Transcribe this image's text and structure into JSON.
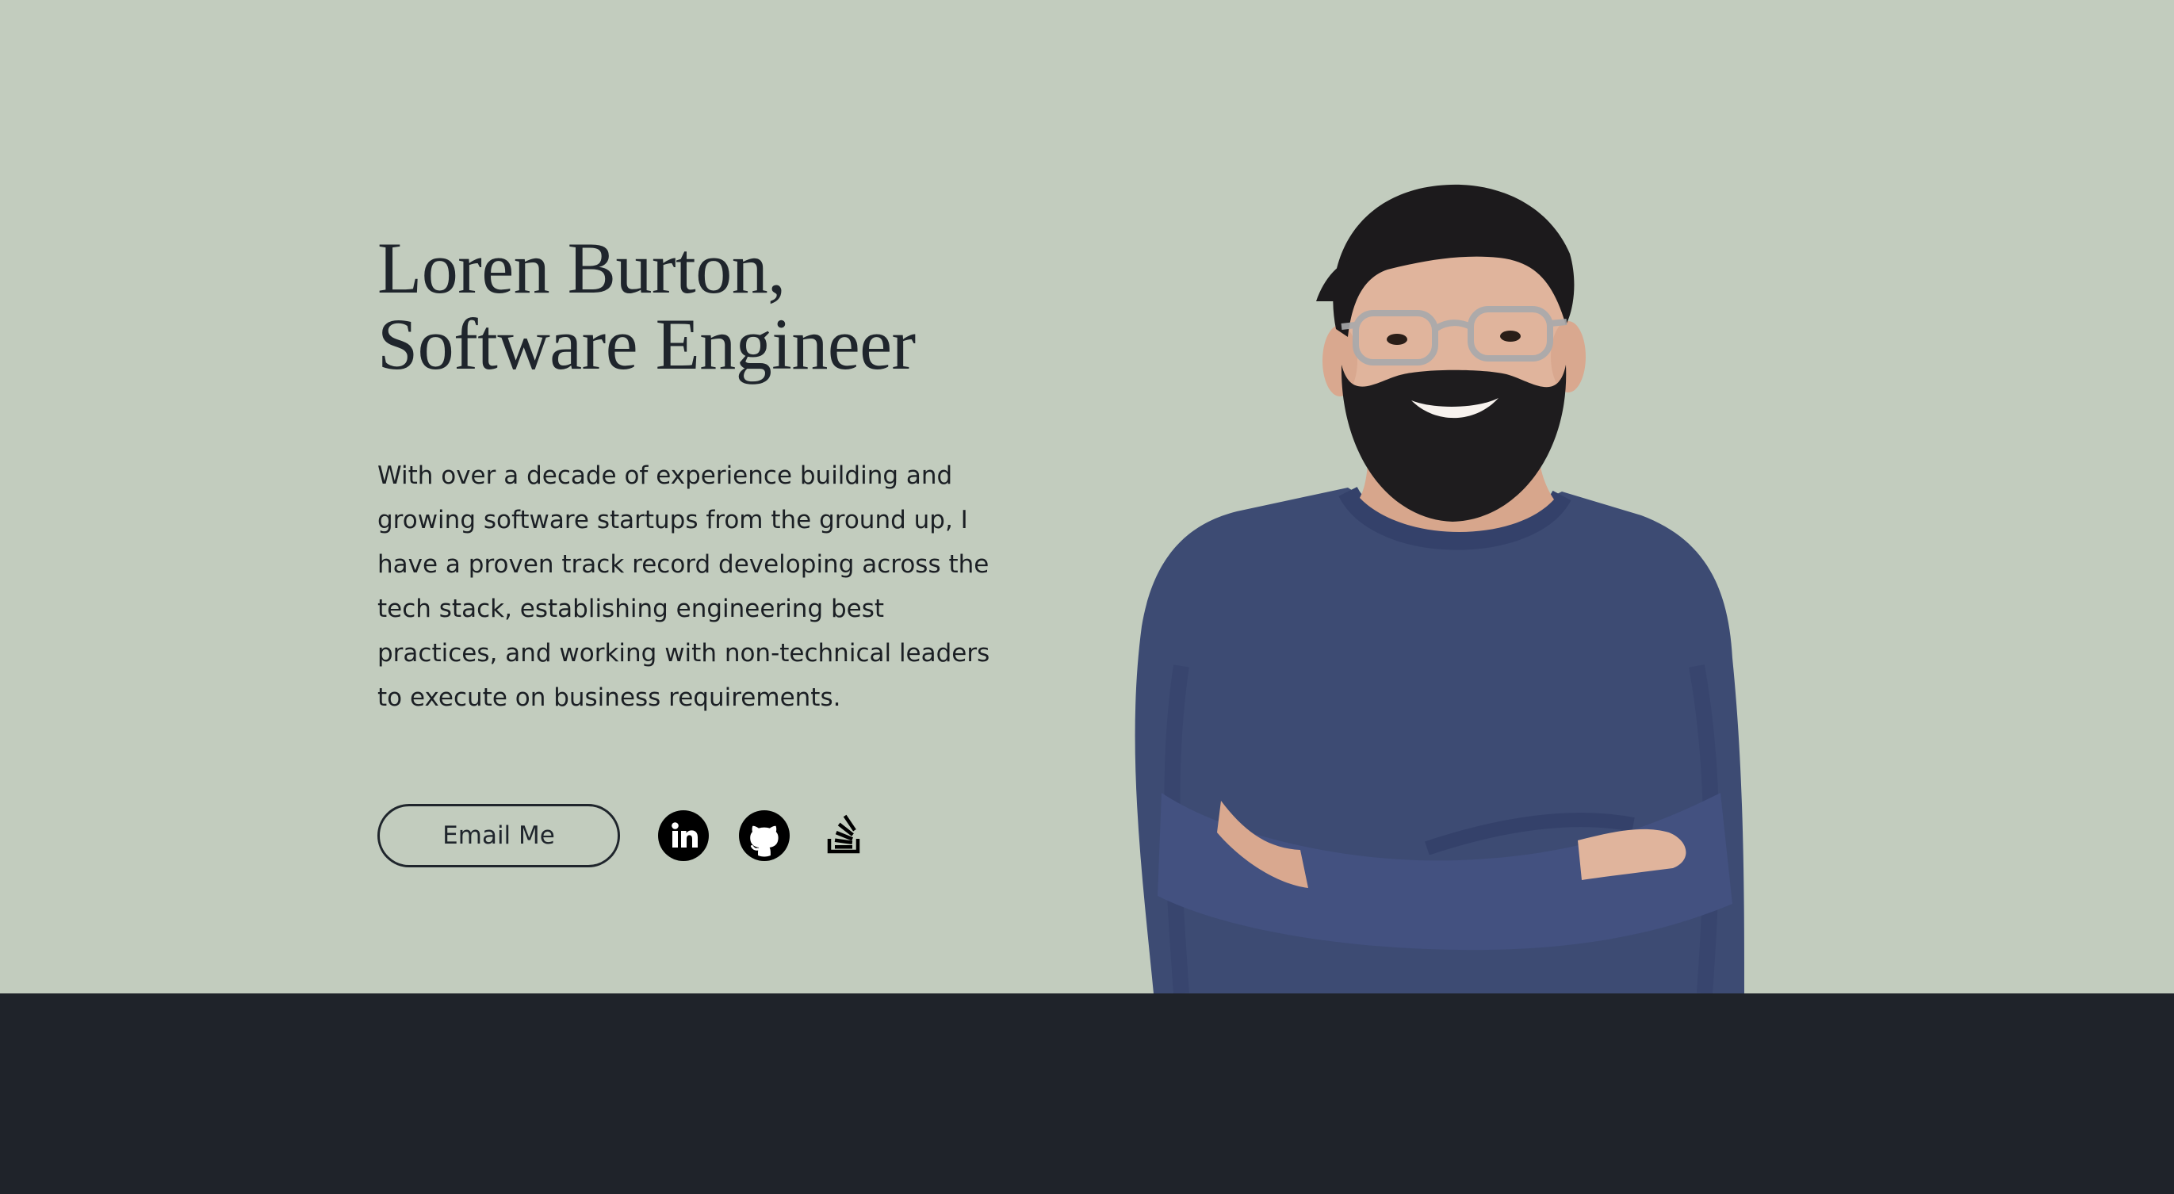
{
  "hero": {
    "title_line1": "Loren Burton,",
    "title_line2": "Software Engineer",
    "bio": "With over a decade of experience building and growing software startups from the ground up, I have a proven track record developing across the tech stack, establishing engineering best practices, and working with non-technical leaders to execute on business requirements.",
    "email_button_label": "Email Me"
  },
  "social": [
    {
      "icon": "linkedin-icon"
    },
    {
      "icon": "github-icon"
    },
    {
      "icon": "stack-overflow-icon"
    }
  ],
  "colors": {
    "hero_background": "#c2ccbe",
    "footer_background": "#1f232a",
    "text": "#1f252c",
    "icon": "#000000"
  },
  "portrait": {
    "description_colors": {
      "sweater": "#3d4b73",
      "skin": "#e0b49c",
      "hair": "#1c1a1c"
    }
  }
}
